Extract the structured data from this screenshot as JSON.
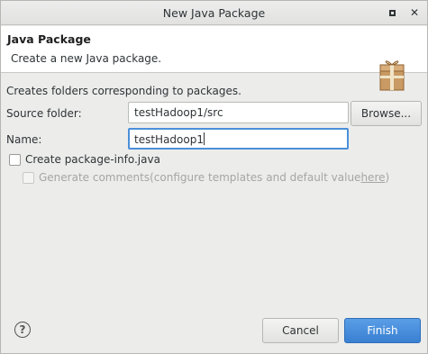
{
  "window": {
    "title": "New Java Package"
  },
  "titlebar_buttons": {
    "close_glyph": "✕"
  },
  "banner": {
    "title": "Java Package",
    "description": "Create a new Java package.",
    "icon": "package-wizard-icon"
  },
  "form": {
    "description": "Creates folders corresponding to packages.",
    "source_folder_label": "Source folder:",
    "source_folder_value": "testHadoop1/src",
    "browse_label": "Browse...",
    "name_label": "Name:",
    "name_value": "testHadoop1",
    "create_package_info_label": "Create package-info.java",
    "create_package_info_checked": false,
    "generate_comments_label": "Generate comments",
    "generate_comments_hint": "(configure templates and default value ",
    "generate_comments_link": "here",
    "generate_comments_close": ")",
    "generate_comments_checked": false
  },
  "footer": {
    "help_glyph": "?",
    "cancel_label": "Cancel",
    "finish_label": "Finish"
  },
  "colors": {
    "accent": "#3a80d2",
    "focus": "#4a90d9"
  }
}
